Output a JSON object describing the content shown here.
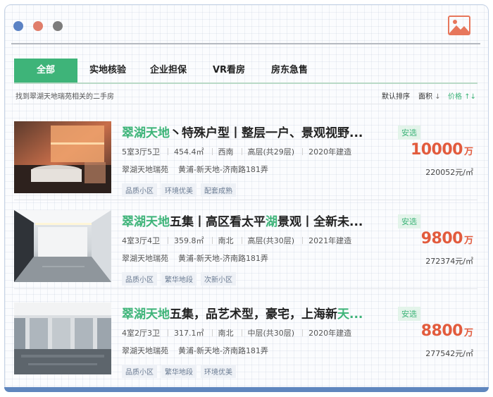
{
  "colors": {
    "accent": "#3eb479",
    "price": "#e25b3d",
    "frame": "#5f86be"
  },
  "window_icon": "image-icon",
  "tabs": [
    {
      "label": "全部",
      "active": true
    },
    {
      "label": "实地核验",
      "active": false
    },
    {
      "label": "企业担保",
      "active": false
    },
    {
      "label": "VR看房",
      "active": false
    },
    {
      "label": "房东急售",
      "active": false
    }
  ],
  "result_hint": "找到翠湖天地瑞苑相关的二手房",
  "sort": {
    "default": "默认排序",
    "area": "面积",
    "area_arrow": "↓",
    "price": "价格",
    "price_arrow": "↑↓"
  },
  "listings": [
    {
      "title_hl": "翠湖天地",
      "title_rest": "丶特殊户型丨整层一户、景观视野...",
      "badge": "安选",
      "layout": "5室3厅5卫",
      "area": "454.4㎡",
      "orientation": "西南",
      "floor": "高层(共29层)",
      "year": "2020年建造",
      "community": "翠湖天地瑞苑",
      "location": "黄浦-新天地-济南路181弄",
      "tags": [
        "品质小区",
        "环境优美",
        "配套成熟"
      ],
      "price": "10000",
      "price_unit": "万",
      "unit_price": "220052元/㎡"
    },
    {
      "title_hl": "翠湖天地",
      "title_mid": "五集丨高区看太平",
      "title_hl2": "湖",
      "title_rest": "景观丨全新未...",
      "badge": "安选",
      "layout": "4室3厅4卫",
      "area": "359.8㎡",
      "orientation": "南北",
      "floor": "高层(共30层)",
      "year": "2021年建造",
      "community": "翠湖天地瑞苑",
      "location": "黄浦-新天地-济南路181弄",
      "tags": [
        "品质小区",
        "繁华地段",
        "次新小区"
      ],
      "price": "9800",
      "price_unit": "万",
      "unit_price": "272374元/㎡"
    },
    {
      "title_hl": "翠湖天地",
      "title_mid": "五集，品艺术型，豪宅，上海新",
      "title_hl2": "天...",
      "badge": "安选",
      "layout": "4室2厅3卫",
      "area": "317.1㎡",
      "orientation": "南北",
      "floor": "中层(共30层)",
      "year": "2020年建造",
      "community": "翠湖天地瑞苑",
      "location": "黄浦-新天地-济南路181弄",
      "tags": [
        "品质小区",
        "繁华地段",
        "环境优美"
      ],
      "price": "8800",
      "price_unit": "万",
      "unit_price": "277542元/㎡"
    }
  ]
}
